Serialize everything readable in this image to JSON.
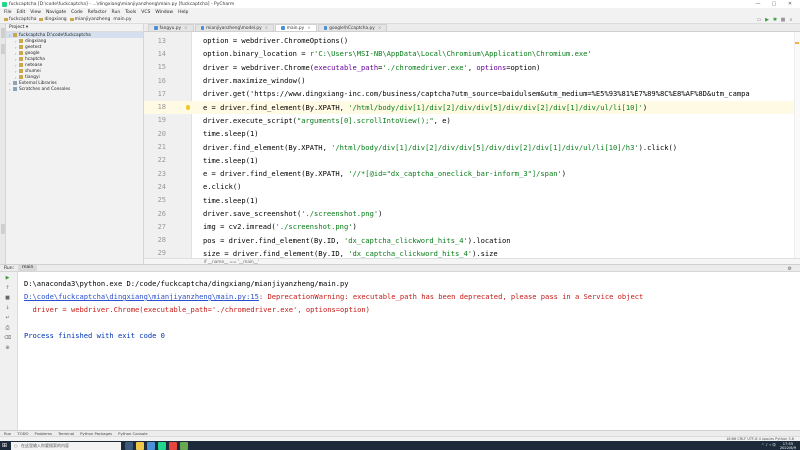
{
  "window": {
    "title": "fuckcaptcha [D:\\code\\fuckcaptcha] - ...\\dingxiang\\mianjiyanzheng\\main.py [fuckcaptcha] - PyCharm",
    "controls": [
      "—",
      "▢",
      "✕"
    ]
  },
  "menu": [
    "File",
    "Edit",
    "View",
    "Navigate",
    "Code",
    "Refactor",
    "Run",
    "Tools",
    "VCS",
    "Window",
    "Help"
  ],
  "nav": {
    "crumbs": [
      "fuckcaptcha",
      "dingxiang",
      "mianjiyanzheng",
      "main.py"
    ]
  },
  "project": {
    "header": "Project ▾",
    "items": [
      {
        "label": "fuckcaptcha D:\\code\\fuckcaptcha",
        "indent": 0,
        "type": "folder",
        "root": true
      },
      {
        "label": "dingxiang",
        "indent": 1,
        "type": "folder"
      },
      {
        "label": "geetest",
        "indent": 1,
        "type": "folder"
      },
      {
        "label": "google",
        "indent": 1,
        "type": "folder"
      },
      {
        "label": "hcaptcha",
        "indent": 1,
        "type": "folder"
      },
      {
        "label": "netease",
        "indent": 1,
        "type": "folder"
      },
      {
        "label": "shumei",
        "indent": 1,
        "type": "folder"
      },
      {
        "label": "tiangyi",
        "indent": 1,
        "type": "folder"
      },
      {
        "label": "External Libraries",
        "indent": 0,
        "type": "lib"
      },
      {
        "label": "Scratches and Consoles",
        "indent": 0,
        "type": "lib"
      }
    ]
  },
  "tabs": [
    {
      "label": "fangyu.py",
      "active": false
    },
    {
      "label": "mianjiyanzheng\\model.py",
      "active": false
    },
    {
      "label": "main.py",
      "active": true
    },
    {
      "label": "google\\hCcaptcha.py",
      "active": false
    }
  ],
  "editor": {
    "lines": [
      {
        "num": "13",
        "code": "option = webdriver.ChromeOptions()"
      },
      {
        "num": "14",
        "code": "option.binary_location = r'C:\\Users\\MSI-NB\\AppData\\Local\\Chromium\\Application\\Chromium.exe'"
      },
      {
        "num": "15",
        "code": "driver = webdriver.Chrome(executable_path='./chromedriver.exe', options=option)"
      },
      {
        "num": "16",
        "code": "driver.maximize_window()"
      },
      {
        "num": "17",
        "code": "driver.get('https://www.dingxiang-inc.com/business/captcha?utm_source=baidulsem&utm_medium=%E5%93%81%E7%89%8C%E8%AF%8D&utm_campa"
      },
      {
        "num": "18",
        "code": "e = driver.find_element(By.XPATH, '/html/body/div[1]/div[2]/div/div[5]/div/div[2]/div[1]/div/ul/li[10]')",
        "current": true
      },
      {
        "num": "19",
        "code": "driver.execute_script(\"arguments[0].scrollIntoView();\", e)"
      },
      {
        "num": "20",
        "code": "time.sleep(1)"
      },
      {
        "num": "21",
        "code": "driver.find_element(By.XPATH, '/html/body/div[1]/div[2]/div/div[5]/div/div[2]/div[1]/div/ul/li[10]/h3').click()"
      },
      {
        "num": "22",
        "code": "time.sleep(1)"
      },
      {
        "num": "23",
        "code": "e = driver.find_element(By.XPATH, '//*[@id=\"dx_captcha_oneclick_bar-inform_3\"]/span')"
      },
      {
        "num": "24",
        "code": "e.click()"
      },
      {
        "num": "25",
        "code": "time.sleep(1)"
      },
      {
        "num": "26",
        "code": "driver.save_screenshot('./screenshot.png')"
      },
      {
        "num": "27",
        "code": "img = cv2.imread('./screenshot.png')"
      },
      {
        "num": "28",
        "code": "pos = driver.find_element(By.ID, 'dx_captcha_clickword_hits_4').location"
      },
      {
        "num": "29",
        "code": "size = driver.find_element(By.ID, 'dx_captcha_clickword_hits_4').size"
      }
    ]
  },
  "breadcrumb": "if __name__ == '__main__'",
  "run": {
    "label": "Run:",
    "tab": "main",
    "console": {
      "cmd": "D:\\anaconda3\\python.exe D:/code/fuckcaptcha/dingxiang/mianjiyanzheng/main.py",
      "warn_link": "D:\\code\\fuckcaptcha\\dingxiang\\mianjiyanzheng\\main.py:15",
      "warn_text": ": DeprecationWarning: executable_path has been deprecated, please pass in a Service object",
      "warn_code": "  driver = webdriver.Chrome(executable_path='./chromedriver.exe', options=option)",
      "exit": "Process finished with exit code 0"
    }
  },
  "bottom_tabs": [
    "Run",
    "TODO",
    "Problems",
    "Terminal",
    "Python Packages",
    "Python Console"
  ],
  "status": {
    "right": "18:66   CRLF   UTF-8   4 spaces   Python 3.8"
  },
  "taskbar": {
    "search_placeholder": "在这里输入你要搜索的内容",
    "time": "17:55",
    "date": "2022/6/9"
  }
}
